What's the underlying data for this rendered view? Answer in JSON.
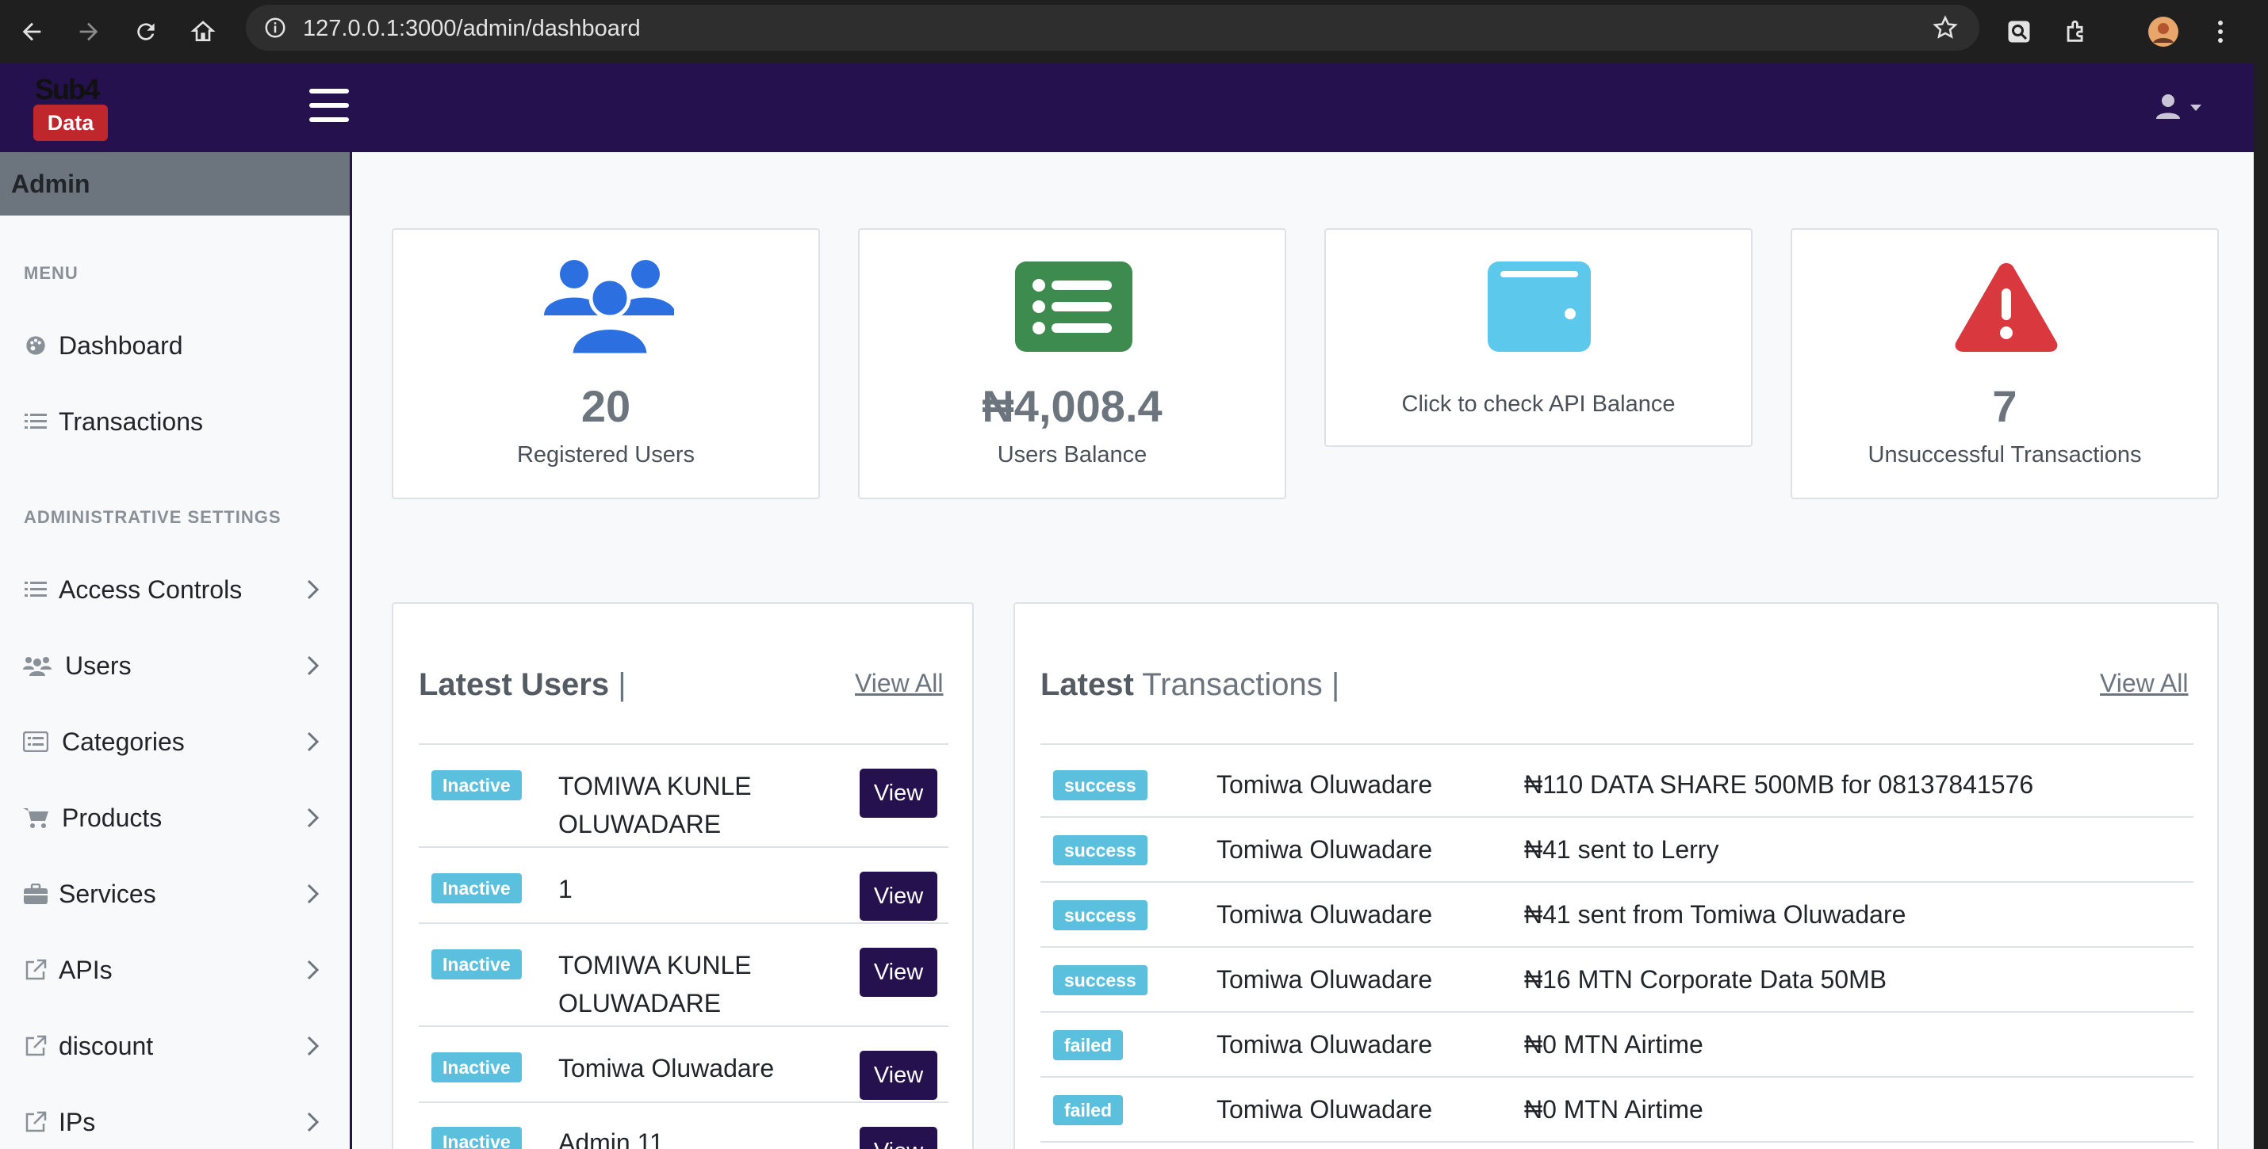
{
  "browser": {
    "url": "127.0.0.1:3000/admin/dashboard"
  },
  "brand": {
    "logo_top": "Sub4",
    "logo_box": "Data"
  },
  "sidebar": {
    "header": "Admin",
    "menu_title": "MENU",
    "menu_items": [
      {
        "label": "Dashboard",
        "icon": "palette-icon"
      },
      {
        "label": "Transactions",
        "icon": "list-icon"
      }
    ],
    "settings_title": "ADMINISTRATIVE SETTINGS",
    "settings_items": [
      {
        "label": "Access Controls",
        "icon": "list-icon"
      },
      {
        "label": "Users",
        "icon": "users-icon"
      },
      {
        "label": "Categories",
        "icon": "list-alt-icon"
      },
      {
        "label": "Products",
        "icon": "cart-icon"
      },
      {
        "label": "Services",
        "icon": "briefcase-icon"
      },
      {
        "label": "APIs",
        "icon": "external-link-icon"
      },
      {
        "label": "discount",
        "icon": "external-link-icon"
      },
      {
        "label": "IPs",
        "icon": "external-link-icon"
      }
    ]
  },
  "stats": [
    {
      "value": "20",
      "label": "Registered Users",
      "icon": "users-icon",
      "color": "#2b6fe0"
    },
    {
      "value": "₦4,008.4",
      "label": "Users Balance",
      "icon": "list-icon",
      "color": "#3d8b4f"
    },
    {
      "value": "",
      "label": "Click to check API Balance",
      "icon": "wallet-icon",
      "color": "#5bc8ec"
    },
    {
      "value": "7",
      "label": "Unsuccessful Transactions",
      "icon": "warning-icon",
      "color": "#d9393e"
    }
  ],
  "latest_users": {
    "title_bold": "Latest Users",
    "title_suffix": " |",
    "view_all": "View All",
    "view_label": "View",
    "rows": [
      {
        "status": "Inactive",
        "name_line1": "TOMIWA KUNLE",
        "name_line2": "OLUWADARE"
      },
      {
        "status": "Inactive",
        "name_line1": "1",
        "name_line2": ""
      },
      {
        "status": "Inactive",
        "name_line1": "TOMIWA KUNLE",
        "name_line2": "OLUWADARE"
      },
      {
        "status": "Inactive",
        "name_line1": "Tomiwa Oluwadare",
        "name_line2": ""
      },
      {
        "status": "Inactive",
        "name_line1": "Admin 11",
        "name_line2": ""
      }
    ]
  },
  "latest_transactions": {
    "title_bold": "Latest",
    "title_rest": " Transactions |",
    "view_all": "View All",
    "rows": [
      {
        "status": "success",
        "user": "Tomiwa Oluwadare",
        "detail": "₦110 DATA SHARE 500MB for 08137841576"
      },
      {
        "status": "success",
        "user": "Tomiwa Oluwadare",
        "detail": "₦41 sent to Lerry"
      },
      {
        "status": "success",
        "user": "Tomiwa Oluwadare",
        "detail": "₦41 sent from Tomiwa Oluwadare"
      },
      {
        "status": "success",
        "user": "Tomiwa Oluwadare",
        "detail": "₦16 MTN Corporate Data 50MB"
      },
      {
        "status": "failed",
        "user": "Tomiwa Oluwadare",
        "detail": "₦0 MTN Airtime"
      },
      {
        "status": "failed",
        "user": "Tomiwa Oluwadare",
        "detail": "₦0 MTN Airtime"
      }
    ]
  }
}
